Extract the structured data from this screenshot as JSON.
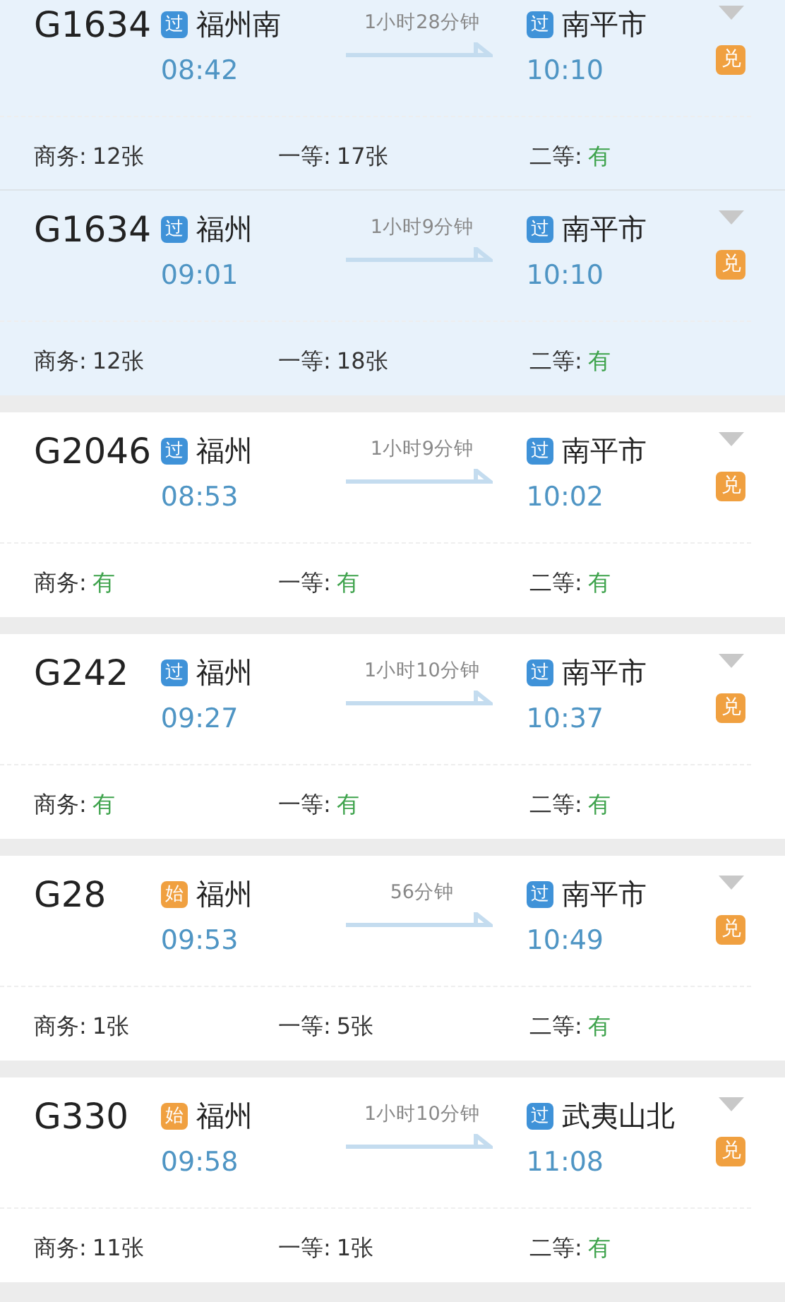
{
  "trains": [
    {
      "number": "G1634",
      "highlighted": true,
      "from": {
        "badge": "过",
        "kind": "pass",
        "station": "福州南",
        "time": "08:42"
      },
      "duration": "1小时28分钟",
      "to": {
        "badge": "过",
        "kind": "pass",
        "station": "南平市",
        "time": "10:10"
      },
      "exchange": "兑",
      "seats": [
        {
          "label": "商务:",
          "value": "12张",
          "kind": "count"
        },
        {
          "label": "一等:",
          "value": "17张",
          "kind": "count"
        },
        {
          "label": "二等:",
          "value": "有",
          "kind": "plenty"
        }
      ]
    },
    {
      "number": "G1634",
      "highlighted": true,
      "from": {
        "badge": "过",
        "kind": "pass",
        "station": "福州",
        "time": "09:01"
      },
      "duration": "1小时9分钟",
      "to": {
        "badge": "过",
        "kind": "pass",
        "station": "南平市",
        "time": "10:10"
      },
      "exchange": "兑",
      "seats": [
        {
          "label": "商务:",
          "value": "12张",
          "kind": "count"
        },
        {
          "label": "一等:",
          "value": "18张",
          "kind": "count"
        },
        {
          "label": "二等:",
          "value": "有",
          "kind": "plenty"
        }
      ]
    },
    {
      "number": "G2046",
      "highlighted": false,
      "from": {
        "badge": "过",
        "kind": "pass",
        "station": "福州",
        "time": "08:53"
      },
      "duration": "1小时9分钟",
      "to": {
        "badge": "过",
        "kind": "pass",
        "station": "南平市",
        "time": "10:02"
      },
      "exchange": "兑",
      "seats": [
        {
          "label": "商务:",
          "value": "有",
          "kind": "plenty"
        },
        {
          "label": "一等:",
          "value": "有",
          "kind": "plenty"
        },
        {
          "label": "二等:",
          "value": "有",
          "kind": "plenty"
        }
      ]
    },
    {
      "number": "G242",
      "highlighted": false,
      "from": {
        "badge": "过",
        "kind": "pass",
        "station": "福州",
        "time": "09:27"
      },
      "duration": "1小时10分钟",
      "to": {
        "badge": "过",
        "kind": "pass",
        "station": "南平市",
        "time": "10:37"
      },
      "exchange": "兑",
      "seats": [
        {
          "label": "商务:",
          "value": "有",
          "kind": "plenty"
        },
        {
          "label": "一等:",
          "value": "有",
          "kind": "plenty"
        },
        {
          "label": "二等:",
          "value": "有",
          "kind": "plenty"
        }
      ]
    },
    {
      "number": "G28",
      "highlighted": false,
      "from": {
        "badge": "始",
        "kind": "start",
        "station": "福州",
        "time": "09:53"
      },
      "duration": "56分钟",
      "to": {
        "badge": "过",
        "kind": "pass",
        "station": "南平市",
        "time": "10:49"
      },
      "exchange": "兑",
      "seats": [
        {
          "label": "商务:",
          "value": "1张",
          "kind": "count"
        },
        {
          "label": "一等:",
          "value": "5张",
          "kind": "count"
        },
        {
          "label": "二等:",
          "value": "有",
          "kind": "plenty"
        }
      ]
    },
    {
      "number": "G330",
      "highlighted": false,
      "from": {
        "badge": "始",
        "kind": "start",
        "station": "福州",
        "time": "09:58"
      },
      "duration": "1小时10分钟",
      "to": {
        "badge": "过",
        "kind": "pass",
        "station": "武夷山北",
        "time": "11:08"
      },
      "exchange": "兑",
      "seats": [
        {
          "label": "商务:",
          "value": "11张",
          "kind": "count"
        },
        {
          "label": "一等:",
          "value": "1张",
          "kind": "count"
        },
        {
          "label": "二等:",
          "value": "有",
          "kind": "plenty"
        }
      ]
    }
  ]
}
